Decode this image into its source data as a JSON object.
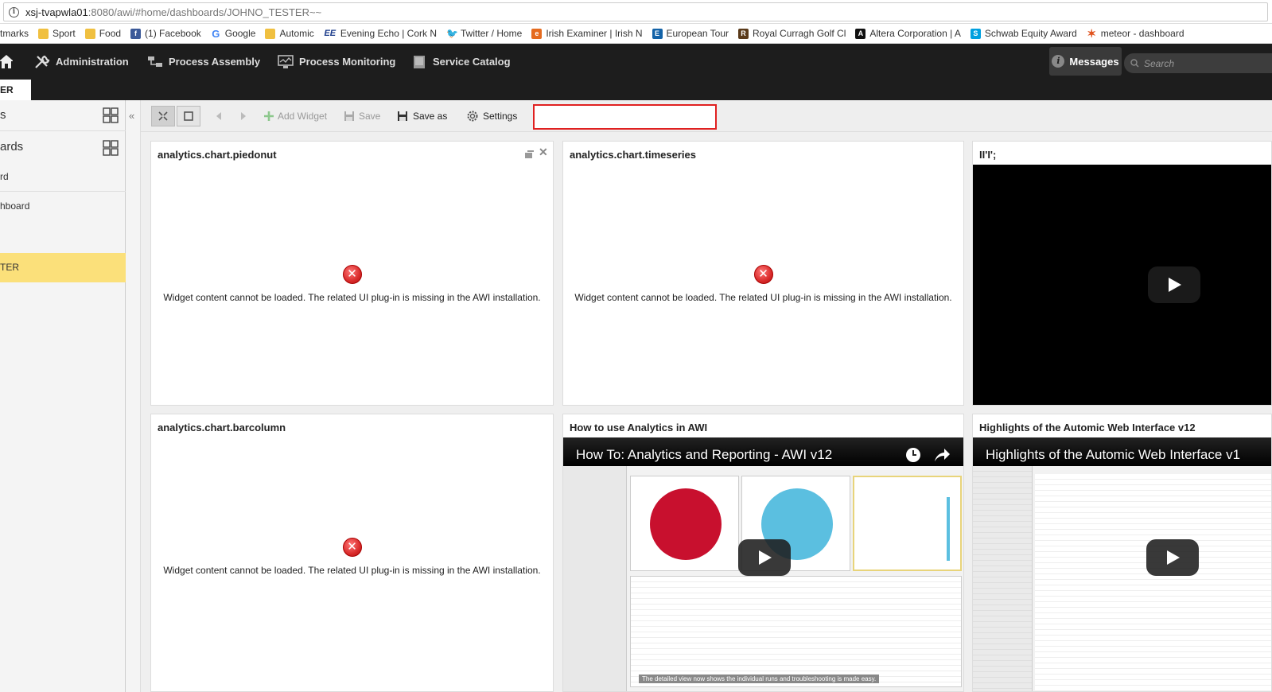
{
  "browser": {
    "url_host": "xsj-tvapwla01",
    "url_rest": ":8080/awi/#home/dashboards/JOHNO_TESTER~~",
    "bookmarks": [
      {
        "label": "tmarks",
        "icon": "none"
      },
      {
        "label": "Sport",
        "icon": "folder-icon"
      },
      {
        "label": "Food",
        "icon": "folder-icon"
      },
      {
        "label": "(1) Facebook",
        "icon": "facebook-icon"
      },
      {
        "label": "Google",
        "icon": "google-icon"
      },
      {
        "label": "Automic",
        "icon": "folder-icon"
      },
      {
        "label": "Evening Echo | Cork N",
        "icon": "evening-echo-icon"
      },
      {
        "label": "Twitter / Home",
        "icon": "twitter-icon"
      },
      {
        "label": "Irish Examiner | Irish N",
        "icon": "irish-examiner-icon"
      },
      {
        "label": "European Tour",
        "icon": "european-tour-icon"
      },
      {
        "label": "Royal Curragh Golf Cl",
        "icon": "royal-curragh-icon"
      },
      {
        "label": "Altera Corporation | A",
        "icon": "altera-icon"
      },
      {
        "label": "Schwab Equity Award",
        "icon": "schwab-icon"
      },
      {
        "label": "meteor - dashboard",
        "icon": "meteor-icon"
      }
    ]
  },
  "header": {
    "nav": [
      {
        "label": "Administration",
        "icon": "tools-icon"
      },
      {
        "label": "Process Assembly",
        "icon": "process-assembly-icon"
      },
      {
        "label": "Process Monitoring",
        "icon": "monitor-icon"
      },
      {
        "label": "Service Catalog",
        "icon": "catalog-icon"
      }
    ],
    "messages_label": "Messages",
    "search_placeholder": "Search"
  },
  "tabs": {
    "active_label": "ER"
  },
  "sidebar": {
    "section1": "s",
    "section2": "ards",
    "items": [
      "rd",
      "hboard",
      "TER"
    ]
  },
  "toolbar": {
    "add_widget": "Add Widget",
    "save": "Save",
    "save_as": "Save as",
    "settings": "Settings"
  },
  "widgets": {
    "piedonut_title": "analytics.chart.piedonut",
    "timeseries_title": "analytics.chart.timeseries",
    "third_title": "II'I';",
    "barcolumn_title": "analytics.chart.barcolumn",
    "video1_title": "How to use Analytics in AWI",
    "video2_title": "Highlights of the Automic Web Interface v12",
    "error_message": "Widget content cannot be loaded. The related UI plug-in is missing in the AWI installation.",
    "video1_overlay": "How To: Analytics and Reporting - AWI v12",
    "video2_overlay": "Highlights of the Automic Web Interface v1",
    "video1_caption": "The detailed view now shows the individual runs and troubleshooting is made easy."
  },
  "colors": {
    "header_bg": "#1d1d1d",
    "highlight": "#fbe07a",
    "error_red": "#d92b2b",
    "selection_box": "#e02020"
  }
}
